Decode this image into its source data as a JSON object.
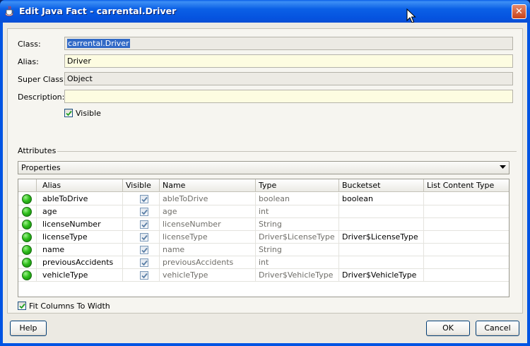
{
  "window": {
    "title": "Edit Java Fact - carrental.Driver",
    "close_label": "✕"
  },
  "form": {
    "class_label": "Class:",
    "class_value": "carrental.Driver",
    "alias_label": "Alias:",
    "alias_value": "Driver",
    "superclass_label": "Super Class:",
    "superclass_value": "Object",
    "description_label": "Description:",
    "description_value": "",
    "visible_label": "Visible",
    "visible_checked": true
  },
  "attributes": {
    "group_label": "Attributes",
    "dropdown_value": "Properties",
    "columns": [
      "Alias",
      "Visible",
      "Name",
      "Type",
      "Bucketset",
      "List Content Type"
    ],
    "rows": [
      {
        "alias": "ableToDrive",
        "visible": true,
        "name": "ableToDrive",
        "type": "boolean",
        "bucketset": "boolean",
        "list_content_type": ""
      },
      {
        "alias": "age",
        "visible": true,
        "name": "age",
        "type": "int",
        "bucketset": "",
        "list_content_type": ""
      },
      {
        "alias": "licenseNumber",
        "visible": true,
        "name": "licenseNumber",
        "type": "String",
        "bucketset": "",
        "list_content_type": ""
      },
      {
        "alias": "licenseType",
        "visible": true,
        "name": "licenseType",
        "type": "Driver$LicenseType",
        "bucketset": "Driver$LicenseType",
        "list_content_type": ""
      },
      {
        "alias": "name",
        "visible": true,
        "name": "name",
        "type": "String",
        "bucketset": "",
        "list_content_type": ""
      },
      {
        "alias": "previousAccidents",
        "visible": true,
        "name": "previousAccidents",
        "type": "int",
        "bucketset": "",
        "list_content_type": ""
      },
      {
        "alias": "vehicleType",
        "visible": true,
        "name": "vehicleType",
        "type": "Driver$VehicleType",
        "bucketset": "Driver$VehicleType",
        "list_content_type": ""
      }
    ],
    "fit_columns_label": "Fit Columns To Width",
    "fit_columns_checked": true
  },
  "buttons": {
    "help": "Help",
    "ok": "OK",
    "cancel": "Cancel"
  },
  "colors": {
    "title_bar": "#0054e3",
    "selection": "#3169c6",
    "editable_field": "#fdfce1",
    "status_dot": "#2fbf1c"
  }
}
